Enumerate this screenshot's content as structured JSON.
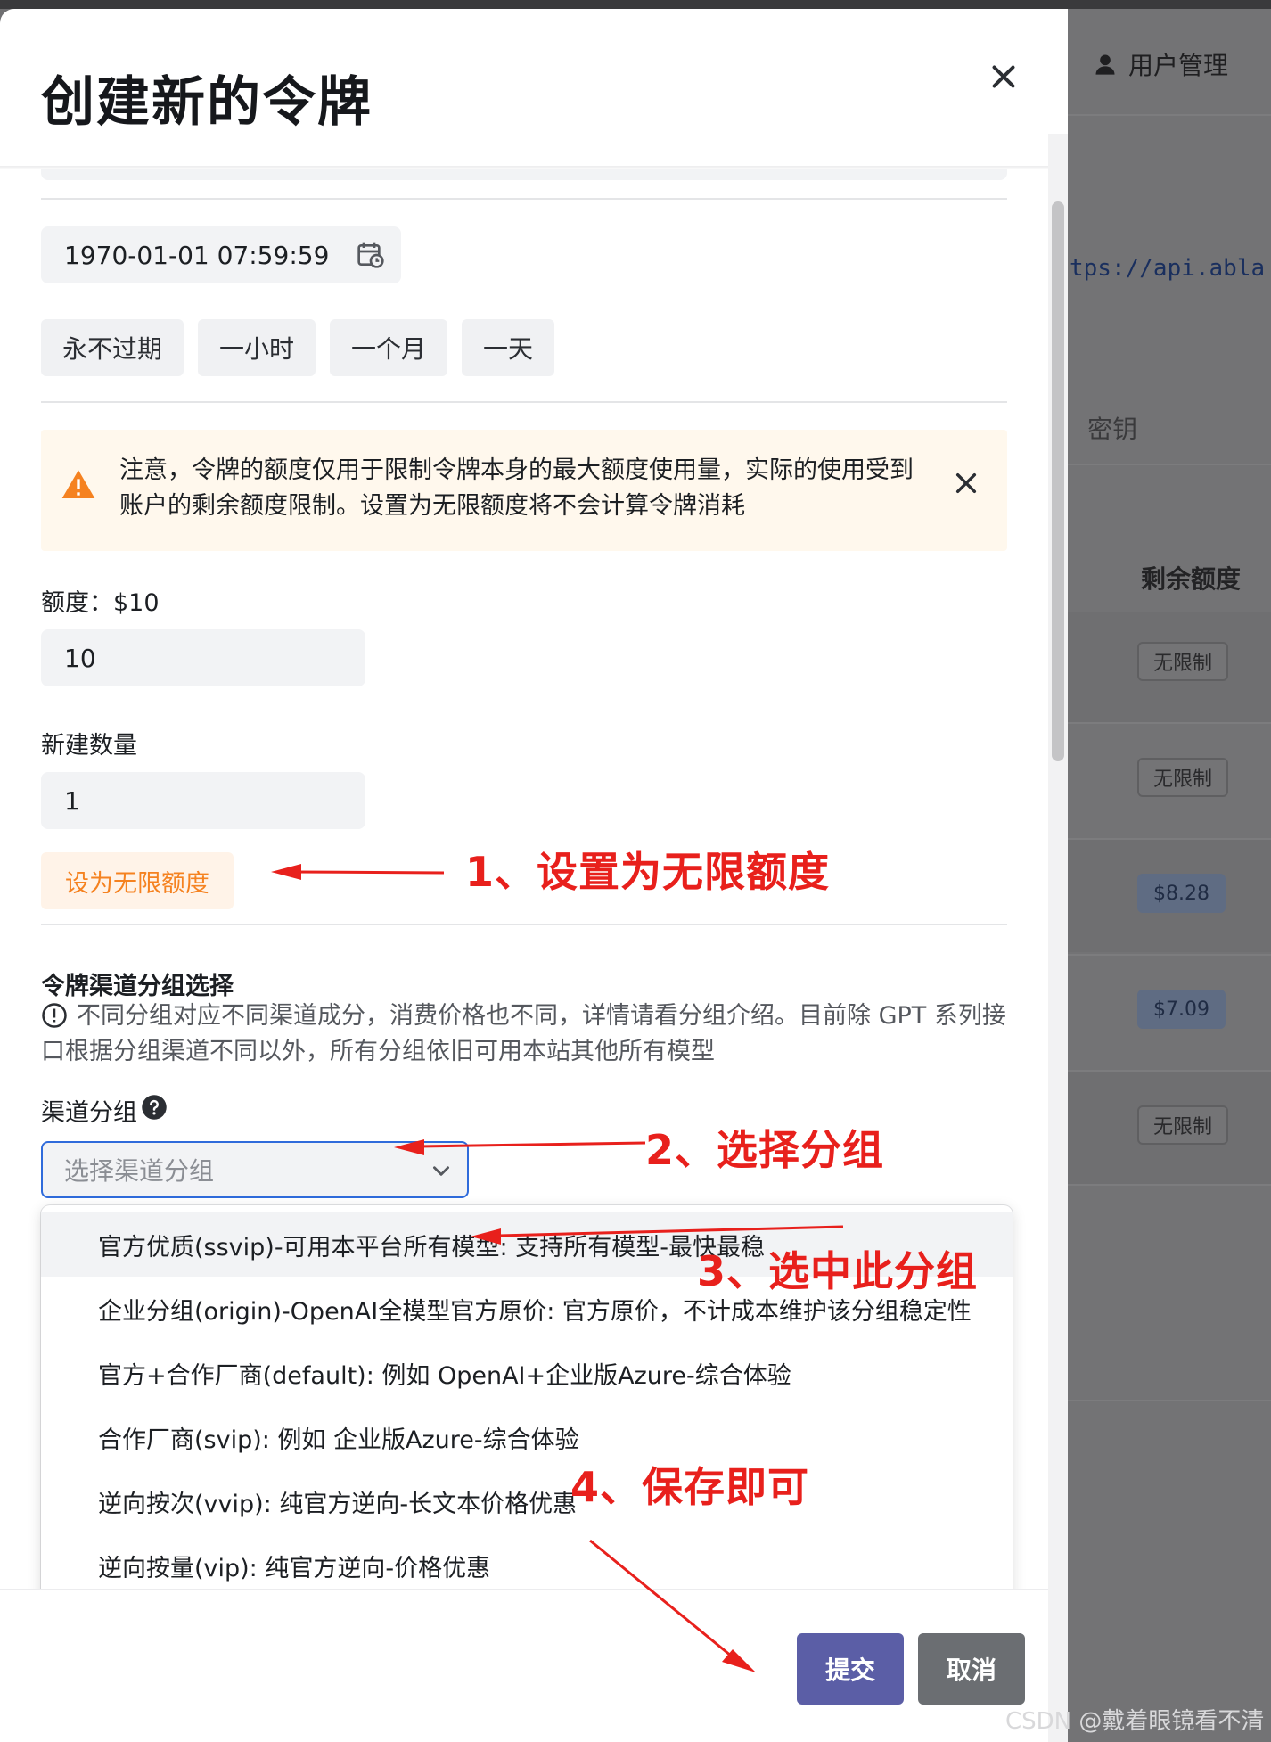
{
  "modal": {
    "title": "创建新的令牌",
    "expire_datetime": "1970-01-01 07:59:59",
    "quick_buttons": [
      "永不过期",
      "一小时",
      "一个月",
      "一天"
    ],
    "alert_text": "注意，令牌的额度仅用于限制令牌本身的最大额度使用量，实际的使用受到账户的剩余额度限制。设置为无限额度将不会计算令牌消耗",
    "quota_label": "额度：$10",
    "quota_value": "10",
    "count_label": "新建数量",
    "count_value": "1",
    "unlimited_button": "设为无限额度",
    "group_section_title": "令牌渠道分组选择",
    "group_description": "不同分组对应不同渠道成分，消费价格也不同，详情请看分组介绍。目前除 GPT 系列接口根据分组渠道不同以外，所有分组依旧可用本站其他所有模型",
    "group_label": "渠道分组",
    "group_placeholder": "选择渠道分组",
    "group_options": [
      "官方优质(ssvip)-可用本平台所有模型: 支持所有模型-最快最稳",
      "企业分组(origin)-OpenAI全模型官方原价: 官方原价，不计成本维护该分组稳定性",
      "官方+合作厂商(default): 例如 OpenAI+企业版Azure-综合体验",
      "合作厂商(svip): 例如 企业版Azure-综合体验",
      "逆向按次(vvip): 纯官方逆向-长文本价格优惠",
      "逆向按量(vip): 纯官方逆向-价格优惠"
    ],
    "submit_label": "提交",
    "cancel_label": "取消"
  },
  "background": {
    "user_menu": "用户管理",
    "api_url_fragment": "tps://api.abla",
    "key_header": "密钥",
    "remaining_header": "剩余额度",
    "quota_tags": [
      "无限制",
      "无限制",
      "$8.28",
      "$7.09",
      "无限制"
    ]
  },
  "annotations": {
    "step1": "1、设置为无限额度",
    "step2": "2、选择分组",
    "step3": "3、选中此分组",
    "step4": "4、保存即可"
  },
  "watermark": "CSDN @戴着眼镜看不清",
  "colors": {
    "primary": "#5b5ea6",
    "focus_border": "#2f6bdb",
    "warning": "#f58220",
    "annotation": "#e8201c"
  }
}
